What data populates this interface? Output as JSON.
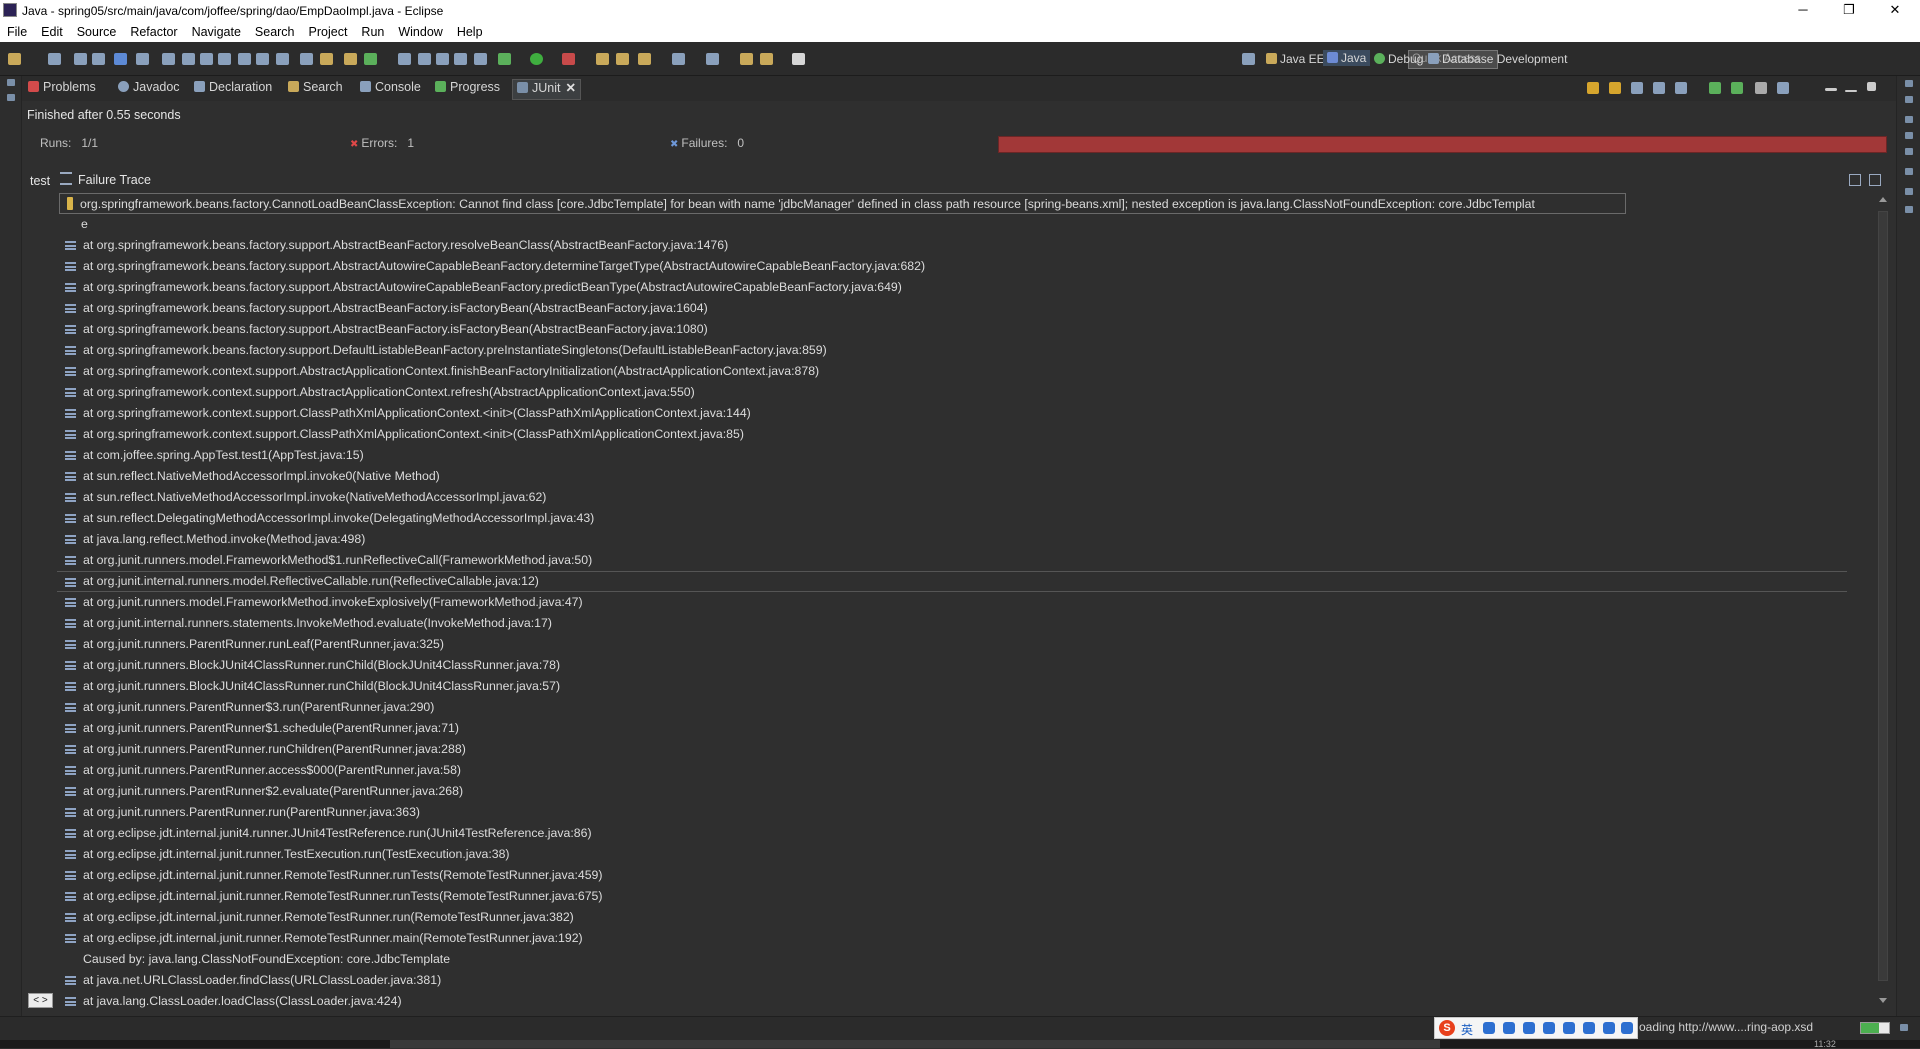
{
  "window": {
    "title": "Java - spring05/src/main/java/com/joffee/spring/dao/EmpDaoImpl.java - Eclipse",
    "minimize_glyph": "─",
    "restore_glyph": "❐",
    "close_glyph": "✕"
  },
  "menu": [
    "File",
    "Edit",
    "Source",
    "Refactor",
    "Navigate",
    "Search",
    "Project",
    "Run",
    "Window",
    "Help"
  ],
  "toolbar": {
    "quick_access_placeholder": "Quick Access",
    "perspectives": [
      "Java EE",
      "Java",
      "Debug",
      "Database Development"
    ],
    "active_perspective": "Java"
  },
  "tabs": [
    {
      "label": "Problems",
      "icon": "problems-icon"
    },
    {
      "label": "Javadoc",
      "icon": "javadoc-icon"
    },
    {
      "label": "Declaration",
      "icon": "declaration-icon"
    },
    {
      "label": "Search",
      "icon": "search-icon"
    },
    {
      "label": "Console",
      "icon": "console-icon"
    },
    {
      "label": "Progress",
      "icon": "progress-icon"
    },
    {
      "label": "JUnit",
      "icon": "junit-icon",
      "active": true
    }
  ],
  "junit": {
    "status": "Finished after 0.55 seconds",
    "runs_label": "Runs:",
    "runs_value": "1/1",
    "errors_label": "Errors:",
    "errors_value": "1",
    "failures_label": "Failures:",
    "failures_value": "0",
    "progress_fraction": 1.0,
    "bar_color": "#a23838",
    "tests_label": "test",
    "trace_title": "Failure Trace"
  },
  "trace": {
    "first_line": "org.springframework.beans.factory.CannotLoadBeanClassException: Cannot find class [core.JdbcTemplate] for bean with name 'jdbcManager' defined in class path resource [spring-beans.xml]; nested exception is java.lang.ClassNotFoundException: core.JdbcTemplat",
    "first_line_cont": "e",
    "frames": [
      "at org.springframework.beans.factory.support.AbstractBeanFactory.resolveBeanClass(AbstractBeanFactory.java:1476)",
      "at org.springframework.beans.factory.support.AbstractAutowireCapableBeanFactory.determineTargetType(AbstractAutowireCapableBeanFactory.java:682)",
      "at org.springframework.beans.factory.support.AbstractAutowireCapableBeanFactory.predictBeanType(AbstractAutowireCapableBeanFactory.java:649)",
      "at org.springframework.beans.factory.support.AbstractBeanFactory.isFactoryBean(AbstractBeanFactory.java:1604)",
      "at org.springframework.beans.factory.support.AbstractBeanFactory.isFactoryBean(AbstractBeanFactory.java:1080)",
      "at org.springframework.beans.factory.support.DefaultListableBeanFactory.preInstantiateSingletons(DefaultListableBeanFactory.java:859)",
      "at org.springframework.context.support.AbstractApplicationContext.finishBeanFactoryInitialization(AbstractApplicationContext.java:878)",
      "at org.springframework.context.support.AbstractApplicationContext.refresh(AbstractApplicationContext.java:550)",
      "at org.springframework.context.support.ClassPathXmlApplicationContext.<init>(ClassPathXmlApplicationContext.java:144)",
      "at org.springframework.context.support.ClassPathXmlApplicationContext.<init>(ClassPathXmlApplicationContext.java:85)",
      "at com.joffee.spring.AppTest.test1(AppTest.java:15)",
      "at sun.reflect.NativeMethodAccessorImpl.invoke0(Native Method)",
      "at sun.reflect.NativeMethodAccessorImpl.invoke(NativeMethodAccessorImpl.java:62)",
      "at sun.reflect.DelegatingMethodAccessorImpl.invoke(DelegatingMethodAccessorImpl.java:43)",
      "at java.lang.reflect.Method.invoke(Method.java:498)",
      "at org.junit.runners.model.FrameworkMethod$1.runReflectiveCall(FrameworkMethod.java:50)",
      "at org.junit.internal.runners.model.ReflectiveCallable.run(ReflectiveCallable.java:12)",
      "at org.junit.runners.model.FrameworkMethod.invokeExplosively(FrameworkMethod.java:47)",
      "at org.junit.internal.runners.statements.InvokeMethod.evaluate(InvokeMethod.java:17)",
      "at org.junit.runners.ParentRunner.runLeaf(ParentRunner.java:325)",
      "at org.junit.runners.BlockJUnit4ClassRunner.runChild(BlockJUnit4ClassRunner.java:78)",
      "at org.junit.runners.BlockJUnit4ClassRunner.runChild(BlockJUnit4ClassRunner.java:57)",
      "at org.junit.runners.ParentRunner$3.run(ParentRunner.java:290)",
      "at org.junit.runners.ParentRunner$1.schedule(ParentRunner.java:71)",
      "at org.junit.runners.ParentRunner.runChildren(ParentRunner.java:288)",
      "at org.junit.runners.ParentRunner.access$000(ParentRunner.java:58)",
      "at org.junit.runners.ParentRunner$2.evaluate(ParentRunner.java:268)",
      "at org.junit.runners.ParentRunner.run(ParentRunner.java:363)",
      "at org.eclipse.jdt.internal.junit4.runner.JUnit4TestReference.run(JUnit4TestReference.java:86)",
      "at org.eclipse.jdt.internal.junit.runner.TestExecution.run(TestExecution.java:38)",
      "at org.eclipse.jdt.internal.junit.runner.RemoteTestRunner.runTests(RemoteTestRunner.java:459)",
      "at org.eclipse.jdt.internal.junit.runner.RemoteTestRunner.runTests(RemoteTestRunner.java:675)",
      "at org.eclipse.jdt.internal.junit.runner.RemoteTestRunner.run(RemoteTestRunner.java:382)",
      "at org.eclipse.jdt.internal.junit.runner.RemoteTestRunner.main(RemoteTestRunner.java:192)"
    ],
    "selected_frame_index": 16,
    "caused_by": "Caused by: java.lang.ClassNotFoundException: core.JdbcTemplate",
    "cause_frames": [
      "at java.net.URLClassLoader.findClass(URLClassLoader.java:381)",
      "at java.lang.ClassLoader.loadClass(ClassLoader.java:424)"
    ]
  },
  "statusbar": {
    "ime_logo": "S",
    "ime_mode": "英",
    "loading_text": "oading http://www....ring-aop.xsd",
    "clock_peek": "11:32"
  },
  "scroll_toggle_label": "< >"
}
